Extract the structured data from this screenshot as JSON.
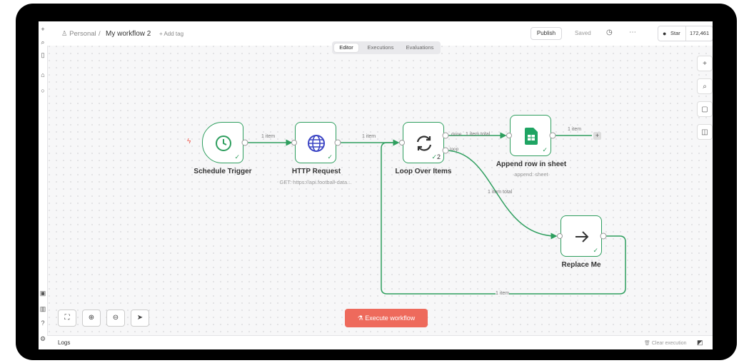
{
  "breadcrumb": {
    "owner": "Personal",
    "separator": "/",
    "workflow_name": "My workflow 2",
    "add_tag": "+ Add tag"
  },
  "toolbar": {
    "publish": "Publish",
    "saved": "Saved",
    "history_icon": "history-icon",
    "more": "⋯",
    "star": "Star",
    "star_count": "172,461"
  },
  "tabs": [
    {
      "label": "Editor",
      "active": true
    },
    {
      "label": "Executions",
      "active": false
    },
    {
      "label": "Evaluations",
      "active": false
    }
  ],
  "nodes": {
    "schedule": {
      "label": "Schedule Trigger"
    },
    "http": {
      "label": "HTTP Request",
      "subtitle": "GET: https://api.football-data..."
    },
    "loop": {
      "label": "Loop Over Items",
      "count": "2",
      "out_done": "done",
      "out_loop": "loop"
    },
    "append": {
      "label": "Append row in sheet",
      "subtitle": "append: sheet"
    },
    "replace": {
      "label": "Replace Me"
    }
  },
  "edges": {
    "e1": "1 item",
    "e2": "1 item",
    "e3": "1 item total",
    "e4": "1 item",
    "e5": "1 item total",
    "e6": "1 item"
  },
  "controls": {
    "execute": "Execute workflow"
  },
  "logs": {
    "label": "Logs",
    "clear": "Clear execution"
  },
  "colors": {
    "accent_green": "#2e9e5e",
    "execute_red": "#ee6a5c",
    "trigger_bolt": "#ee5c4f"
  }
}
